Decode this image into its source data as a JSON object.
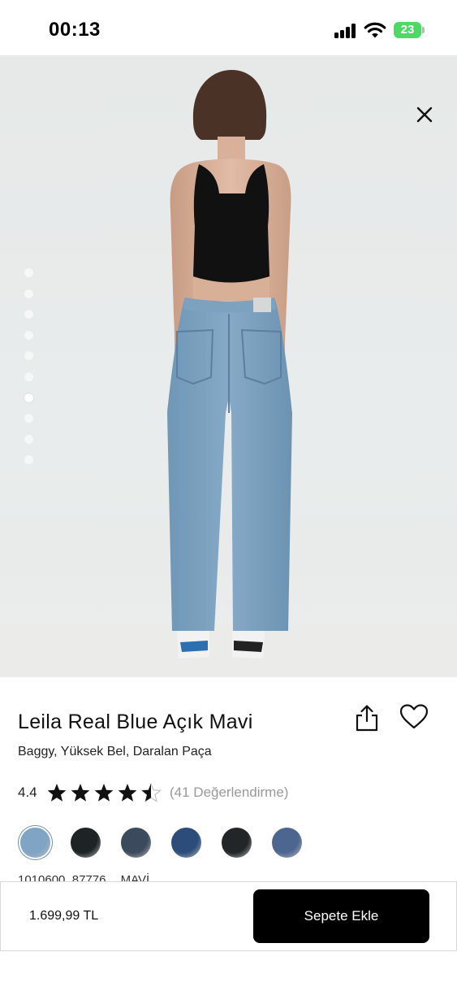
{
  "status_bar": {
    "time": "00:13",
    "battery": "23"
  },
  "product": {
    "title": "Leila Real Blue Açık Mavi",
    "subtitle": "Baggy, Yüksek Bel, Daralan Paça",
    "rating": "4.4",
    "rating_stars": 4.5,
    "review_count": "(41 Değerlendirme)",
    "sku": "1010600_87776",
    "color_name": "MAVİ",
    "gallery_total": 10,
    "gallery_active": 7
  },
  "swatches": [
    {
      "color": "#7fa4c4",
      "name": "light blue"
    },
    {
      "color": "#1e2426",
      "name": "black"
    },
    {
      "color": "#3b4a5c",
      "name": "dark blue"
    },
    {
      "color": "#2c4d7a",
      "name": "indigo"
    },
    {
      "color": "#232628",
      "name": "dark grey"
    },
    {
      "color": "#4d6690",
      "name": "mid blue"
    }
  ],
  "cart": {
    "price": "1.699,99 TL",
    "button_label": "Sepete Ekle"
  },
  "icons": {
    "close": "close-icon",
    "share": "share-icon",
    "favorite": "heart-icon"
  }
}
